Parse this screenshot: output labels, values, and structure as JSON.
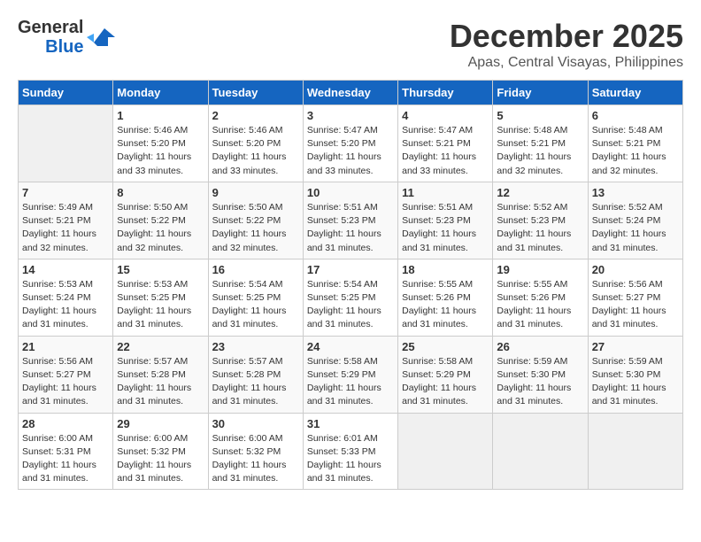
{
  "logo": {
    "line1": "General",
    "line2": "Blue"
  },
  "title": "December 2025",
  "subtitle": "Apas, Central Visayas, Philippines",
  "days_of_week": [
    "Sunday",
    "Monday",
    "Tuesday",
    "Wednesday",
    "Thursday",
    "Friday",
    "Saturday"
  ],
  "weeks": [
    [
      {
        "day": "",
        "sunrise": "",
        "sunset": "",
        "daylight": ""
      },
      {
        "day": "1",
        "sunrise": "Sunrise: 5:46 AM",
        "sunset": "Sunset: 5:20 PM",
        "daylight": "Daylight: 11 hours and 33 minutes."
      },
      {
        "day": "2",
        "sunrise": "Sunrise: 5:46 AM",
        "sunset": "Sunset: 5:20 PM",
        "daylight": "Daylight: 11 hours and 33 minutes."
      },
      {
        "day": "3",
        "sunrise": "Sunrise: 5:47 AM",
        "sunset": "Sunset: 5:20 PM",
        "daylight": "Daylight: 11 hours and 33 minutes."
      },
      {
        "day": "4",
        "sunrise": "Sunrise: 5:47 AM",
        "sunset": "Sunset: 5:21 PM",
        "daylight": "Daylight: 11 hours and 33 minutes."
      },
      {
        "day": "5",
        "sunrise": "Sunrise: 5:48 AM",
        "sunset": "Sunset: 5:21 PM",
        "daylight": "Daylight: 11 hours and 32 minutes."
      },
      {
        "day": "6",
        "sunrise": "Sunrise: 5:48 AM",
        "sunset": "Sunset: 5:21 PM",
        "daylight": "Daylight: 11 hours and 32 minutes."
      }
    ],
    [
      {
        "day": "7",
        "sunrise": "Sunrise: 5:49 AM",
        "sunset": "Sunset: 5:21 PM",
        "daylight": "Daylight: 11 hours and 32 minutes."
      },
      {
        "day": "8",
        "sunrise": "Sunrise: 5:50 AM",
        "sunset": "Sunset: 5:22 PM",
        "daylight": "Daylight: 11 hours and 32 minutes."
      },
      {
        "day": "9",
        "sunrise": "Sunrise: 5:50 AM",
        "sunset": "Sunset: 5:22 PM",
        "daylight": "Daylight: 11 hours and 32 minutes."
      },
      {
        "day": "10",
        "sunrise": "Sunrise: 5:51 AM",
        "sunset": "Sunset: 5:23 PM",
        "daylight": "Daylight: 11 hours and 31 minutes."
      },
      {
        "day": "11",
        "sunrise": "Sunrise: 5:51 AM",
        "sunset": "Sunset: 5:23 PM",
        "daylight": "Daylight: 11 hours and 31 minutes."
      },
      {
        "day": "12",
        "sunrise": "Sunrise: 5:52 AM",
        "sunset": "Sunset: 5:23 PM",
        "daylight": "Daylight: 11 hours and 31 minutes."
      },
      {
        "day": "13",
        "sunrise": "Sunrise: 5:52 AM",
        "sunset": "Sunset: 5:24 PM",
        "daylight": "Daylight: 11 hours and 31 minutes."
      }
    ],
    [
      {
        "day": "14",
        "sunrise": "Sunrise: 5:53 AM",
        "sunset": "Sunset: 5:24 PM",
        "daylight": "Daylight: 11 hours and 31 minutes."
      },
      {
        "day": "15",
        "sunrise": "Sunrise: 5:53 AM",
        "sunset": "Sunset: 5:25 PM",
        "daylight": "Daylight: 11 hours and 31 minutes."
      },
      {
        "day": "16",
        "sunrise": "Sunrise: 5:54 AM",
        "sunset": "Sunset: 5:25 PM",
        "daylight": "Daylight: 11 hours and 31 minutes."
      },
      {
        "day": "17",
        "sunrise": "Sunrise: 5:54 AM",
        "sunset": "Sunset: 5:25 PM",
        "daylight": "Daylight: 11 hours and 31 minutes."
      },
      {
        "day": "18",
        "sunrise": "Sunrise: 5:55 AM",
        "sunset": "Sunset: 5:26 PM",
        "daylight": "Daylight: 11 hours and 31 minutes."
      },
      {
        "day": "19",
        "sunrise": "Sunrise: 5:55 AM",
        "sunset": "Sunset: 5:26 PM",
        "daylight": "Daylight: 11 hours and 31 minutes."
      },
      {
        "day": "20",
        "sunrise": "Sunrise: 5:56 AM",
        "sunset": "Sunset: 5:27 PM",
        "daylight": "Daylight: 11 hours and 31 minutes."
      }
    ],
    [
      {
        "day": "21",
        "sunrise": "Sunrise: 5:56 AM",
        "sunset": "Sunset: 5:27 PM",
        "daylight": "Daylight: 11 hours and 31 minutes."
      },
      {
        "day": "22",
        "sunrise": "Sunrise: 5:57 AM",
        "sunset": "Sunset: 5:28 PM",
        "daylight": "Daylight: 11 hours and 31 minutes."
      },
      {
        "day": "23",
        "sunrise": "Sunrise: 5:57 AM",
        "sunset": "Sunset: 5:28 PM",
        "daylight": "Daylight: 11 hours and 31 minutes."
      },
      {
        "day": "24",
        "sunrise": "Sunrise: 5:58 AM",
        "sunset": "Sunset: 5:29 PM",
        "daylight": "Daylight: 11 hours and 31 minutes."
      },
      {
        "day": "25",
        "sunrise": "Sunrise: 5:58 AM",
        "sunset": "Sunset: 5:29 PM",
        "daylight": "Daylight: 11 hours and 31 minutes."
      },
      {
        "day": "26",
        "sunrise": "Sunrise: 5:59 AM",
        "sunset": "Sunset: 5:30 PM",
        "daylight": "Daylight: 11 hours and 31 minutes."
      },
      {
        "day": "27",
        "sunrise": "Sunrise: 5:59 AM",
        "sunset": "Sunset: 5:30 PM",
        "daylight": "Daylight: 11 hours and 31 minutes."
      }
    ],
    [
      {
        "day": "28",
        "sunrise": "Sunrise: 6:00 AM",
        "sunset": "Sunset: 5:31 PM",
        "daylight": "Daylight: 11 hours and 31 minutes."
      },
      {
        "day": "29",
        "sunrise": "Sunrise: 6:00 AM",
        "sunset": "Sunset: 5:32 PM",
        "daylight": "Daylight: 11 hours and 31 minutes."
      },
      {
        "day": "30",
        "sunrise": "Sunrise: 6:00 AM",
        "sunset": "Sunset: 5:32 PM",
        "daylight": "Daylight: 11 hours and 31 minutes."
      },
      {
        "day": "31",
        "sunrise": "Sunrise: 6:01 AM",
        "sunset": "Sunset: 5:33 PM",
        "daylight": "Daylight: 11 hours and 31 minutes."
      },
      {
        "day": "",
        "sunrise": "",
        "sunset": "",
        "daylight": ""
      },
      {
        "day": "",
        "sunrise": "",
        "sunset": "",
        "daylight": ""
      },
      {
        "day": "",
        "sunrise": "",
        "sunset": "",
        "daylight": ""
      }
    ]
  ]
}
